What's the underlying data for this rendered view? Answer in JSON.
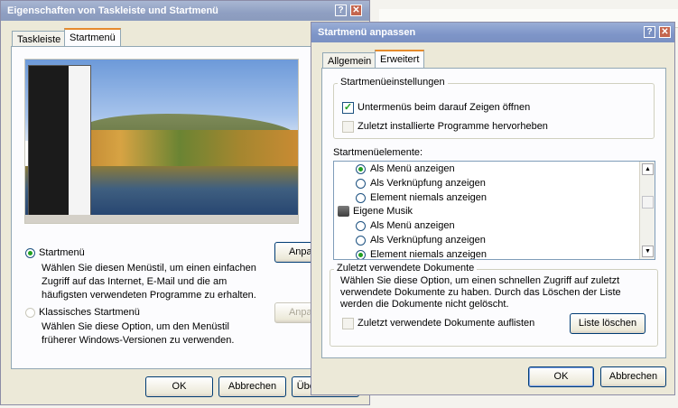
{
  "back_window": {
    "title": "Eigenschaften von Taskleiste und Startmenü",
    "help_glyph": "?",
    "close_glyph": "✕",
    "tabs": [
      "Taskleiste",
      "Startmenü"
    ],
    "startmenu_option": {
      "label": "Startmenü",
      "description": "Wählen Sie diesen Menüstil, um einen einfachen Zugriff auf das Internet, E-Mail und die am häufigsten verwendeten Programme zu erhalten.",
      "customize_label": "Anpassen..."
    },
    "classic_option": {
      "label": "Klassisches Startmenü",
      "description": "Wählen Sie diese Option, um den Menüstil früherer Windows-Versionen zu verwenden.",
      "customize_label": "Anpassen..."
    },
    "buttons": {
      "ok": "OK",
      "cancel": "Abbrechen",
      "apply": "Übernehmen"
    }
  },
  "front_window": {
    "title": "Startmenü anpassen",
    "help_glyph": "?",
    "close_glyph": "✕",
    "tabs": [
      "Allgemein",
      "Erweitert"
    ],
    "settings_group": {
      "label": "Startmenüeinstellungen",
      "submenus_label": "Untermenüs beim darauf Zeigen öffnen",
      "highlight_label": "Zuletzt installierte Programme hervorheben"
    },
    "elements_label": "Startmenüelemente:",
    "list_items": [
      {
        "type": "radio",
        "label": "Als Menü anzeigen",
        "checked": true
      },
      {
        "type": "radio",
        "label": "Als Verknüpfung anzeigen",
        "checked": false
      },
      {
        "type": "radio",
        "label": "Element niemals anzeigen",
        "checked": false
      },
      {
        "type": "header",
        "label": "Eigene Musik"
      },
      {
        "type": "radio",
        "label": "Als Menü anzeigen",
        "checked": false
      },
      {
        "type": "radio",
        "label": "Als Verknüpfung anzeigen",
        "checked": false
      },
      {
        "type": "radio",
        "label": "Element niemals anzeigen",
        "checked": true
      }
    ],
    "recent_group": {
      "label": "Zuletzt verwendete Dokumente",
      "description": "Wählen Sie diese Option, um einen schnellen Zugriff auf zuletzt verwendete Dokumente zu haben. Durch das Löschen der Liste werden die Dokumente nicht gelöscht.",
      "list_label": "Zuletzt verwendete Dokumente auflisten",
      "clear_label": "Liste löschen"
    },
    "buttons": {
      "ok": "OK",
      "cancel": "Abbrechen"
    }
  }
}
